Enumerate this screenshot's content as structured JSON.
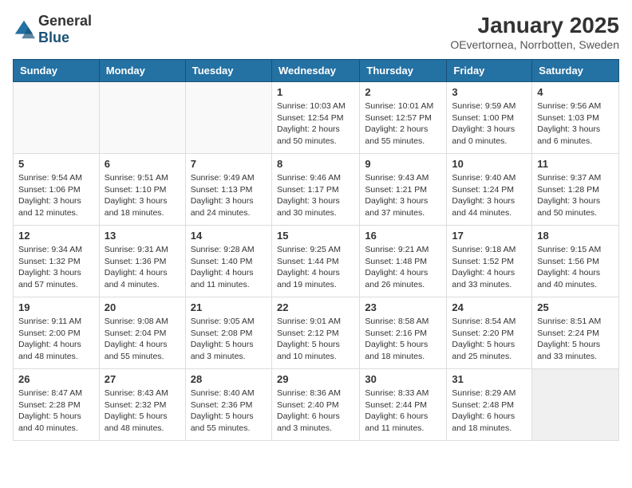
{
  "header": {
    "logo_general": "General",
    "logo_blue": "Blue",
    "title": "January 2025",
    "subtitle": "OEvertornea, Norrbotten, Sweden"
  },
  "weekdays": [
    "Sunday",
    "Monday",
    "Tuesday",
    "Wednesday",
    "Thursday",
    "Friday",
    "Saturday"
  ],
  "weeks": [
    [
      {
        "day": "",
        "info": ""
      },
      {
        "day": "",
        "info": ""
      },
      {
        "day": "",
        "info": ""
      },
      {
        "day": "1",
        "info": "Sunrise: 10:03 AM\nSunset: 12:54 PM\nDaylight: 2 hours and 50 minutes."
      },
      {
        "day": "2",
        "info": "Sunrise: 10:01 AM\nSunset: 12:57 PM\nDaylight: 2 hours and 55 minutes."
      },
      {
        "day": "3",
        "info": "Sunrise: 9:59 AM\nSunset: 1:00 PM\nDaylight: 3 hours and 0 minutes."
      },
      {
        "day": "4",
        "info": "Sunrise: 9:56 AM\nSunset: 1:03 PM\nDaylight: 3 hours and 6 minutes."
      }
    ],
    [
      {
        "day": "5",
        "info": "Sunrise: 9:54 AM\nSunset: 1:06 PM\nDaylight: 3 hours and 12 minutes."
      },
      {
        "day": "6",
        "info": "Sunrise: 9:51 AM\nSunset: 1:10 PM\nDaylight: 3 hours and 18 minutes."
      },
      {
        "day": "7",
        "info": "Sunrise: 9:49 AM\nSunset: 1:13 PM\nDaylight: 3 hours and 24 minutes."
      },
      {
        "day": "8",
        "info": "Sunrise: 9:46 AM\nSunset: 1:17 PM\nDaylight: 3 hours and 30 minutes."
      },
      {
        "day": "9",
        "info": "Sunrise: 9:43 AM\nSunset: 1:21 PM\nDaylight: 3 hours and 37 minutes."
      },
      {
        "day": "10",
        "info": "Sunrise: 9:40 AM\nSunset: 1:24 PM\nDaylight: 3 hours and 44 minutes."
      },
      {
        "day": "11",
        "info": "Sunrise: 9:37 AM\nSunset: 1:28 PM\nDaylight: 3 hours and 50 minutes."
      }
    ],
    [
      {
        "day": "12",
        "info": "Sunrise: 9:34 AM\nSunset: 1:32 PM\nDaylight: 3 hours and 57 minutes."
      },
      {
        "day": "13",
        "info": "Sunrise: 9:31 AM\nSunset: 1:36 PM\nDaylight: 4 hours and 4 minutes."
      },
      {
        "day": "14",
        "info": "Sunrise: 9:28 AM\nSunset: 1:40 PM\nDaylight: 4 hours and 11 minutes."
      },
      {
        "day": "15",
        "info": "Sunrise: 9:25 AM\nSunset: 1:44 PM\nDaylight: 4 hours and 19 minutes."
      },
      {
        "day": "16",
        "info": "Sunrise: 9:21 AM\nSunset: 1:48 PM\nDaylight: 4 hours and 26 minutes."
      },
      {
        "day": "17",
        "info": "Sunrise: 9:18 AM\nSunset: 1:52 PM\nDaylight: 4 hours and 33 minutes."
      },
      {
        "day": "18",
        "info": "Sunrise: 9:15 AM\nSunset: 1:56 PM\nDaylight: 4 hours and 40 minutes."
      }
    ],
    [
      {
        "day": "19",
        "info": "Sunrise: 9:11 AM\nSunset: 2:00 PM\nDaylight: 4 hours and 48 minutes."
      },
      {
        "day": "20",
        "info": "Sunrise: 9:08 AM\nSunset: 2:04 PM\nDaylight: 4 hours and 55 minutes."
      },
      {
        "day": "21",
        "info": "Sunrise: 9:05 AM\nSunset: 2:08 PM\nDaylight: 5 hours and 3 minutes."
      },
      {
        "day": "22",
        "info": "Sunrise: 9:01 AM\nSunset: 2:12 PM\nDaylight: 5 hours and 10 minutes."
      },
      {
        "day": "23",
        "info": "Sunrise: 8:58 AM\nSunset: 2:16 PM\nDaylight: 5 hours and 18 minutes."
      },
      {
        "day": "24",
        "info": "Sunrise: 8:54 AM\nSunset: 2:20 PM\nDaylight: 5 hours and 25 minutes."
      },
      {
        "day": "25",
        "info": "Sunrise: 8:51 AM\nSunset: 2:24 PM\nDaylight: 5 hours and 33 minutes."
      }
    ],
    [
      {
        "day": "26",
        "info": "Sunrise: 8:47 AM\nSunset: 2:28 PM\nDaylight: 5 hours and 40 minutes."
      },
      {
        "day": "27",
        "info": "Sunrise: 8:43 AM\nSunset: 2:32 PM\nDaylight: 5 hours and 48 minutes."
      },
      {
        "day": "28",
        "info": "Sunrise: 8:40 AM\nSunset: 2:36 PM\nDaylight: 5 hours and 55 minutes."
      },
      {
        "day": "29",
        "info": "Sunrise: 8:36 AM\nSunset: 2:40 PM\nDaylight: 6 hours and 3 minutes."
      },
      {
        "day": "30",
        "info": "Sunrise: 8:33 AM\nSunset: 2:44 PM\nDaylight: 6 hours and 11 minutes."
      },
      {
        "day": "31",
        "info": "Sunrise: 8:29 AM\nSunset: 2:48 PM\nDaylight: 6 hours and 18 minutes."
      },
      {
        "day": "",
        "info": ""
      }
    ]
  ]
}
